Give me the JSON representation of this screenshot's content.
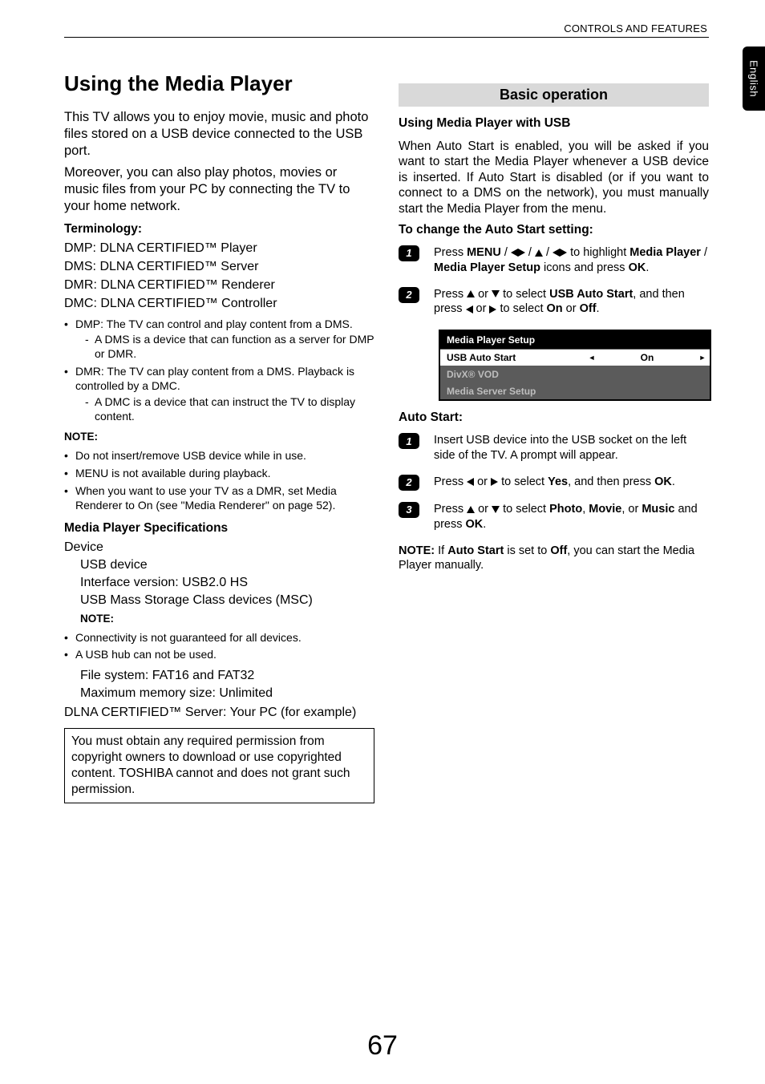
{
  "header": {
    "section": "CONTROLS AND FEATURES",
    "lang": "English"
  },
  "page_number": "67",
  "left": {
    "h1": "Using the Media Player",
    "intro1": "This TV allows you to enjoy movie, music and photo files stored on a USB device connected to the USB port.",
    "intro2": "Moreover, you can also play photos, movies or music files from your PC by connecting the TV to your home network.",
    "terminology_title": "Terminology:",
    "dmp_line": "DMP: DLNA CERTIFIED™ Player",
    "dms_line": "DMS: DLNA CERTIFIED™ Server",
    "dmr_line": "DMR: DLNA CERTIFIED™ Renderer",
    "dmc_line": "DMC: DLNA CERTIFIED™ Controller",
    "bul1": "DMP: The TV can control and play content from a DMS.",
    "sub1": "A DMS is a device that can function as a server for DMP or DMR.",
    "bul2": "DMR: The TV can play content from a DMS. Playback is controlled by a DMC.",
    "sub2": "A DMC is a device that can instruct the TV to display content.",
    "note_t1": "NOTE:",
    "note_b1": "Do not insert/remove USB device while in use.",
    "note_b2": "MENU is not available during playback.",
    "note_b3": "When you want to use your TV as a DMR, set Media Renderer to On (see \"Media Renderer\" on page 52).",
    "specs_title": "Media Player Specifications",
    "device_label": "Device",
    "usb_device": "USB device",
    "iface": "Interface version: USB2.0 HS",
    "msc": "USB Mass Storage Class devices (MSC)",
    "note_t2": "NOTE:",
    "note_c1": "Connectivity is not guaranteed for all devices.",
    "note_c2": "A USB hub can not be used.",
    "fs": "File system:  FAT16 and FAT32",
    "maxmem": "Maximum memory size: Unlimited",
    "dlna_server": "DLNA CERTIFIED™ Server: Your PC (for example)",
    "boxed": "You must obtain any required permission from copyright owners to download or use copyrighted content. TOSHIBA cannot and does not grant such permission."
  },
  "right": {
    "section_title": "Basic operation",
    "usb_title": "Using Media Player with USB",
    "usb_para": "When Auto Start is enabled, you will be asked if you want to start the Media Player whenever a USB device is inserted. If Auto Start is disabled (or if you want to connect to a DMS on the network), you must manually start the Media Player from the menu.",
    "change_title": "To change the Auto Start setting:",
    "step1_a": "Press ",
    "step1_menu": "MENU",
    "step1_b": " / ",
    "step1_c": " / ",
    "step1_d": " / ",
    "step1_e": " to highlight ",
    "step1_mp": "Media Player",
    "step1_f": " / ",
    "step1_mps": "Media Player Setup",
    "step1_g": " icons and press ",
    "step1_ok": "OK",
    "step1_h": ".",
    "step2_a": "Press ",
    "step2_b": " or ",
    "step2_c": " to select ",
    "step2_uas": "USB Auto Start",
    "step2_d": ", and then press ",
    "step2_e": " or ",
    "step2_f": " to select ",
    "step2_on": "On",
    "step2_g": " or ",
    "step2_off": "Off",
    "step2_h": ".",
    "menu": {
      "title": "Media Player Setup",
      "row1_label": "USB Auto Start",
      "row1_value": "On",
      "row2_label": "DivX® VOD",
      "row3_label": "Media Server Setup"
    },
    "auto_title": "Auto Start:",
    "a1": "Insert USB device into the USB socket on the left side of the TV. A prompt will appear.",
    "a2_a": "Press ",
    "a2_b": " or ",
    "a2_c": " to select ",
    "a2_yes": "Yes",
    "a2_d": ", and then press ",
    "a2_ok": "OK",
    "a2_e": ".",
    "a3_a": "Press ",
    "a3_b": " or ",
    "a3_c": " to select ",
    "a3_photo": "Photo",
    "a3_d": ", ",
    "a3_movie": "Movie",
    "a3_e": ", or ",
    "a3_music": "Music",
    "a3_f": " and press ",
    "a3_ok": "OK",
    "a3_g": ".",
    "note_a": "NOTE: ",
    "note_b": "If ",
    "note_as": "Auto Start",
    "note_c": " is set to ",
    "note_off": "Off",
    "note_d": ", you can start the Media Player manually."
  }
}
